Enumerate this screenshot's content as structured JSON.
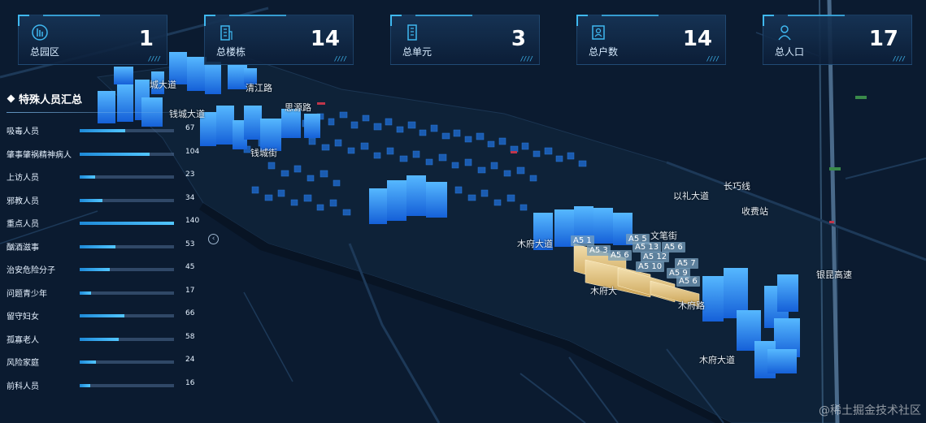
{
  "stats": [
    {
      "label": "总园区",
      "value": "1",
      "icon": "park-icon"
    },
    {
      "label": "总楼栋",
      "value": "14",
      "icon": "building-icon"
    },
    {
      "label": "总单元",
      "value": "3",
      "icon": "unit-icon"
    },
    {
      "label": "总户数",
      "value": "14",
      "icon": "household-icon"
    },
    {
      "label": "总人口",
      "value": "17",
      "icon": "person-icon"
    }
  ],
  "panel": {
    "title": "特殊人员汇总",
    "max": 140,
    "rows": [
      {
        "label": "吸毒人员",
        "value": 67
      },
      {
        "label": "肇事肇祸精神病人",
        "value": 104
      },
      {
        "label": "上访人员",
        "value": 23
      },
      {
        "label": "邪教人员",
        "value": 34
      },
      {
        "label": "重点人员",
        "value": 140
      },
      {
        "label": "酗酒滋事",
        "value": 53
      },
      {
        "label": "治安危险分子",
        "value": 45
      },
      {
        "label": "问题青少年",
        "value": 17
      },
      {
        "label": "留守妇女",
        "value": 66
      },
      {
        "label": "孤寡老人",
        "value": 58
      },
      {
        "label": "风险家庭",
        "value": 24
      },
      {
        "label": "前科人员",
        "value": 16
      }
    ]
  },
  "map": {
    "roads": [
      "城大道",
      "清江路",
      "钱城大道",
      "思源路",
      "钱城街",
      "以礼大道",
      "长巧线",
      "收费站",
      "木府大道",
      "文笔街",
      "木府大",
      "木府路",
      "银昆高速",
      "木府大道"
    ],
    "units": [
      "A5 1",
      "A5 3",
      "A5 5",
      "A5 6",
      "A5 13",
      "A5 12",
      "A5 6",
      "A5 10",
      "A5 7",
      "A5 9",
      "A5 6"
    ]
  },
  "watermark": "@稀土掘金技术社区",
  "colors": {
    "accent": "#3fb8f0",
    "background": "#0a1a2e",
    "building": "#2f8fff"
  }
}
